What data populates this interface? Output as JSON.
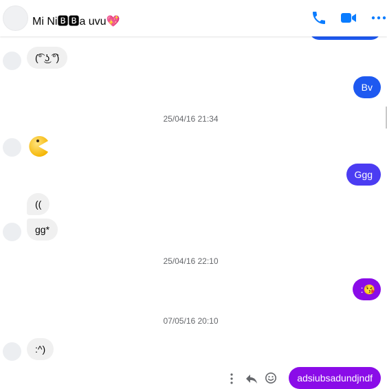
{
  "header": {
    "contact_name": "Mi Ni🅱🅱a uvu💖",
    "icons": [
      "phone-icon",
      "video-icon",
      "more-options-icon"
    ]
  },
  "colors": {
    "accent": "#0a7cff",
    "bubble_blue": "#1e59f0",
    "bubble_indigo": "#4b3cf2",
    "bubble_purple": "#8a0ce8",
    "bubble_incoming": "#f0f0f0",
    "timestamp": "#65676b"
  },
  "messages": [
    {
      "id": "m1",
      "side": "in",
      "text": "(͡° ͜ʖ ͡°)"
    },
    {
      "id": "m2",
      "side": "out",
      "text": "Bv"
    },
    {
      "id": "ts1",
      "type": "timestamp",
      "text": "25/04/16 21:34"
    },
    {
      "id": "m3",
      "side": "in",
      "type": "emoji",
      "icon": "pacman-icon"
    },
    {
      "id": "m4",
      "side": "out",
      "text": "Ggg"
    },
    {
      "id": "m5",
      "side": "in",
      "text": "(("
    },
    {
      "id": "m6",
      "side": "in",
      "text": "gg*"
    },
    {
      "id": "ts2",
      "type": "timestamp",
      "text": "25/04/16 22:10"
    },
    {
      "id": "m7",
      "side": "out",
      "text": ":😘"
    },
    {
      "id": "ts3",
      "type": "timestamp",
      "text": "07/05/16 20:10"
    },
    {
      "id": "m8",
      "side": "in",
      "text": ":^)"
    },
    {
      "id": "m9",
      "side": "out",
      "text": "adsiubsadundjndf"
    }
  ],
  "message_actions": [
    "more-icon",
    "reply-icon",
    "react-emoji-icon"
  ]
}
